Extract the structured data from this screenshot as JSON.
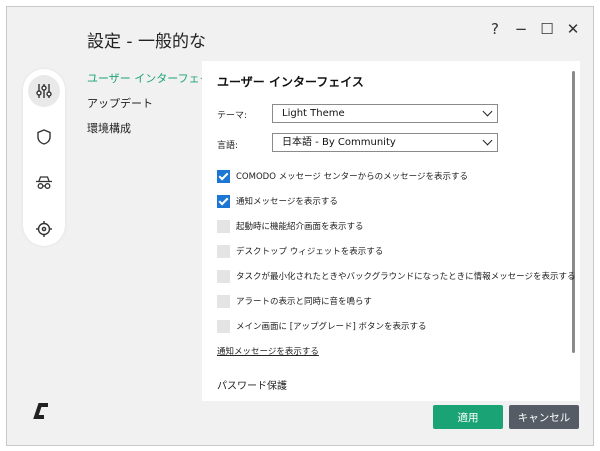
{
  "window": {
    "title": "設定 - 一般的な",
    "controls": {
      "help": "?",
      "minimize": "−",
      "maximize": "☐",
      "close": "✕"
    }
  },
  "rail": {
    "items": [
      {
        "icon": "sliders-icon",
        "active": true
      },
      {
        "icon": "shield-icon",
        "active": false
      },
      {
        "icon": "spy-icon",
        "active": false
      },
      {
        "icon": "crosshair-icon",
        "active": false
      }
    ]
  },
  "nav": {
    "items": [
      {
        "label": "ユーザー インターフェイス",
        "active": true
      },
      {
        "label": "アップデート",
        "active": false
      },
      {
        "label": "環境構成",
        "active": false
      }
    ]
  },
  "panel": {
    "section_title": "ユーザー インターフェイス",
    "theme": {
      "label": "テーマ:",
      "value": "Light Theme"
    },
    "language": {
      "label": "言語:",
      "value": "日本語 - By Community"
    },
    "checkboxes": [
      {
        "label": "COMODO メッセージ センターからのメッセージを表示する",
        "checked": true
      },
      {
        "label": "通知メッセージを表示する",
        "checked": true
      },
      {
        "label": "起動時に機能紹介画面を表示する",
        "checked": false
      },
      {
        "label": "デスクトップ ウィジェットを表示する",
        "checked": false
      },
      {
        "label": "タスクが最小化されたときやバックグラウンドになったときに情報メッセージを表示する",
        "checked": false
      },
      {
        "label": "アラートの表示と同時に音を鳴らす",
        "checked": false
      },
      {
        "label": "メイン画面に [アップグレード] ボタンを表示する",
        "checked": false
      }
    ],
    "link": "通知メッセージを表示する",
    "subsection_title": "パスワード保護"
  },
  "footer": {
    "apply_label": "適用",
    "cancel_label": "キャンセル"
  },
  "colors": {
    "accent": "#1aa476",
    "checkbox": "#1c76d3",
    "cancel": "#565c65"
  }
}
